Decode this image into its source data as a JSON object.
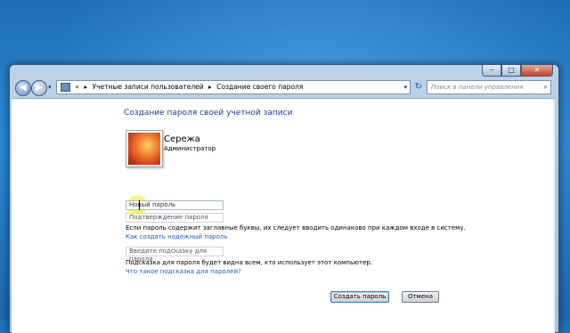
{
  "window": {
    "caption_buttons": {
      "minimize": "‒",
      "maximize": "□",
      "close": "✕"
    }
  },
  "nav": {
    "back_icon": "◀",
    "forward_icon": "▶",
    "recent_icon": "▾",
    "breadcrumb": [
      "Учетные записи пользователей",
      "Создание своего пароля"
    ],
    "breadcrumb_sep": "▸",
    "address_leading_sep": "«",
    "address_dropdown_icon": "▾",
    "refresh_icon": "↻",
    "search_placeholder": "Поиск в панели управления",
    "search_icon": "⌕"
  },
  "page": {
    "title": "Создание пароля своей учетной записи",
    "user": {
      "name": "Сережа",
      "role": "Администратор"
    },
    "fields": {
      "new_password": "Новый пароль",
      "confirm_password": "Подтверждение пароля",
      "hint": "Введите подсказку для пароля"
    },
    "info_caps": "Если пароль содержит заглавные буквы, их следует вводить одинаково при каждом входе в систему.",
    "link_strong_password": "Как создать надежный пароль",
    "info_hint": "Подсказка для пароля будет видна всем, кто использует этот компьютер.",
    "link_what_hint": "Что такое подсказка для паролей?",
    "buttons": {
      "create": "Создать пароль",
      "cancel": "Отмена"
    }
  },
  "colors": {
    "title": "#1e3d8f",
    "link": "#1c5cbf",
    "highlight": "#fff35a"
  }
}
